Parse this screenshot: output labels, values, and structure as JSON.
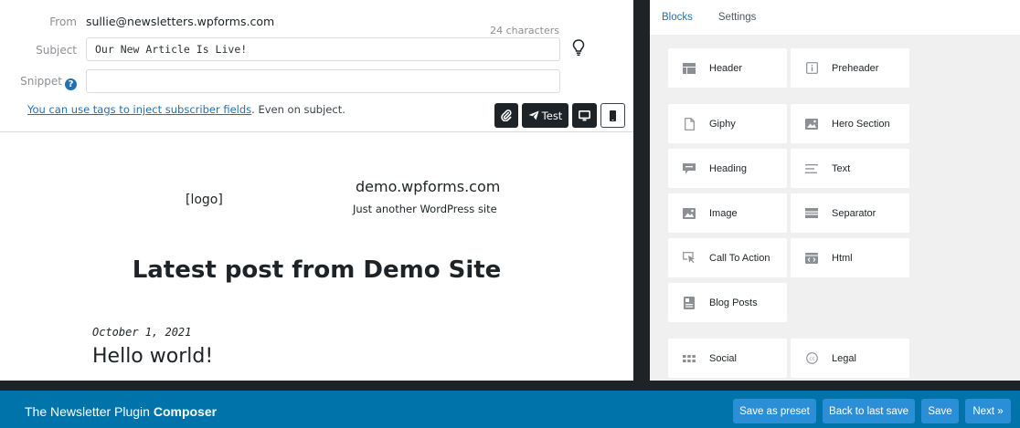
{
  "composer": {
    "from_label": "From",
    "from_value": "sullie@newsletters.wpforms.com",
    "subject_label": "Subject",
    "subject_value": "Our New Article Is Live!",
    "char_count": "24 characters",
    "snippet_label": "Snippet",
    "snippet_value": "",
    "tags_link": "You can use tags to inject subscriber fields",
    "tags_suffix": ". Even on subject.",
    "test_label": "Test"
  },
  "preview": {
    "logo": "[logo]",
    "site_name": "demo.wpforms.com",
    "site_tagline": "Just another WordPress site",
    "heading": "Latest post from Demo Site",
    "post_date": "October 1, 2021",
    "post_title": "Hello world!"
  },
  "panel": {
    "tabs": [
      "Blocks",
      "Settings"
    ],
    "active_tab": "Blocks",
    "blocks": [
      {
        "label": "Header",
        "icon": "header-icon"
      },
      {
        "label": "Preheader",
        "icon": "preheader-icon"
      },
      {
        "label": "Giphy",
        "icon": "giphy-icon"
      },
      {
        "label": "Hero Section",
        "icon": "hero-section-icon"
      },
      {
        "label": "Heading",
        "icon": "heading-icon"
      },
      {
        "label": "Text",
        "icon": "text-icon"
      },
      {
        "label": "Image",
        "icon": "image-icon"
      },
      {
        "label": "Separator",
        "icon": "separator-icon"
      },
      {
        "label": "Call To Action",
        "icon": "call-to-action-icon"
      },
      {
        "label": "Html",
        "icon": "html-icon"
      },
      {
        "label": "Blog Posts",
        "icon": "blog-posts-icon"
      },
      {
        "label": "Social",
        "icon": "social-icon"
      },
      {
        "label": "Legal",
        "icon": "legal-icon"
      }
    ]
  },
  "bottom_bar": {
    "brand_prefix": "The Newsletter Plugin ",
    "brand_bold": "Composer",
    "save_preset": "Save as preset",
    "back_to_last_save": "Back to last save",
    "save": "Save",
    "next": "Next »"
  },
  "colors": {
    "accent": "#0073aa",
    "button": "#2a8fd6",
    "link": "#2271b1",
    "dark": "#1d2327"
  }
}
